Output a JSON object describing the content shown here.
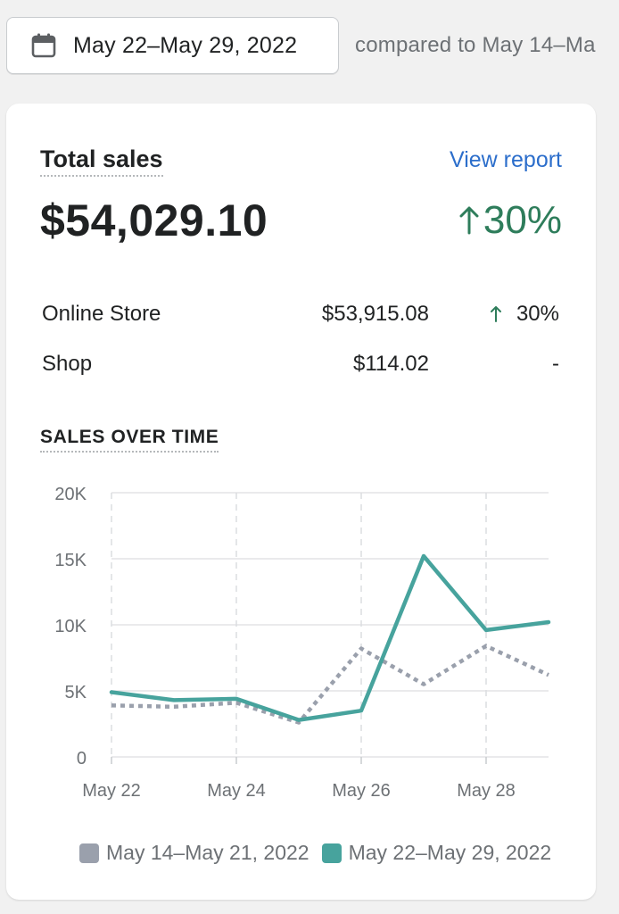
{
  "date_picker": {
    "label": "May 22–May 29, 2022",
    "icon": "calendar-icon"
  },
  "comparison_text": "compared to May 14–Ma",
  "card": {
    "title": "Total sales",
    "view_report": "View report",
    "total_value": "$54,029.10",
    "total_change": "30%",
    "total_change_direction": "up",
    "breakdown": [
      {
        "name": "Online Store",
        "amount": "$53,915.08",
        "change": "30%",
        "direction": "up"
      },
      {
        "name": "Shop",
        "amount": "$114.02",
        "change": "-",
        "direction": "none"
      }
    ],
    "chart_title": "SALES OVER TIME"
  },
  "colors": {
    "current": "#47a39d",
    "previous": "#9aa0ac",
    "positive": "#2e7d5b",
    "link": "#2c6ecb"
  },
  "chart_data": {
    "type": "line",
    "x": [
      "May 22",
      "May 23",
      "May 24",
      "May 25",
      "May 26",
      "May 27",
      "May 28",
      "May 29"
    ],
    "x_tick_labels": [
      "May 22",
      "May 24",
      "May 26",
      "May 28"
    ],
    "y_tick_labels": [
      "20K",
      "15K",
      "10K",
      "5K",
      "0"
    ],
    "ylim": [
      0,
      20000
    ],
    "series": [
      {
        "name": "May 14–May 21, 2022",
        "values": [
          3900,
          3800,
          4100,
          2600,
          8200,
          5500,
          8400,
          6200
        ],
        "style": "dotted"
      },
      {
        "name": "May 22–May 29, 2022",
        "values": [
          4900,
          4300,
          4400,
          2800,
          3500,
          15200,
          9600,
          10200
        ],
        "style": "solid"
      }
    ],
    "grid": true,
    "legend_position": "bottom"
  }
}
